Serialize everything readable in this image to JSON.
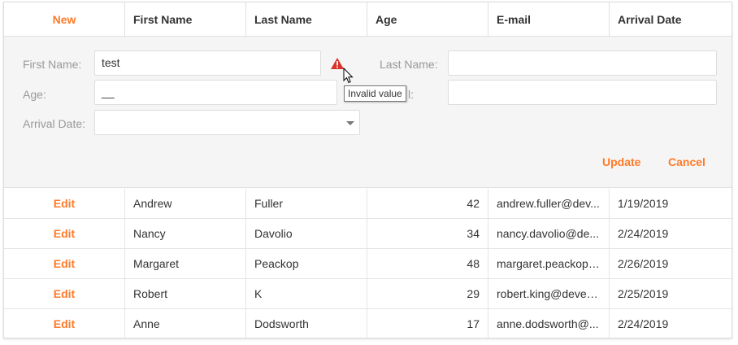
{
  "header": {
    "new_label": "New",
    "columns": [
      "First Name",
      "Last Name",
      "Age",
      "E-mail",
      "Arrival Date"
    ]
  },
  "form": {
    "first_name_label": "First Name:",
    "first_name_value": "test",
    "last_name_label": "Last Name:",
    "last_name_value": "",
    "age_label": "Age:",
    "age_value": "__",
    "email_label_partial": "l:",
    "email_value": "",
    "arrival_label": "Arrival Date:",
    "arrival_value": "",
    "tooltip": "Invalid value",
    "update_label": "Update",
    "cancel_label": "Cancel"
  },
  "rows": [
    {
      "action": "Edit",
      "first": "Andrew",
      "last": "Fuller",
      "age": "42",
      "email": "andrew.fuller@dev...",
      "arrival": "1/19/2019"
    },
    {
      "action": "Edit",
      "first": "Nancy",
      "last": "Davolio",
      "age": "34",
      "email": "nancy.davolio@de...",
      "arrival": "2/24/2019"
    },
    {
      "action": "Edit",
      "first": "Margaret",
      "last": "Peackop",
      "age": "48",
      "email": "margaret.peackop....",
      "arrival": "2/26/2019"
    },
    {
      "action": "Edit",
      "first": "Robert",
      "last": "K",
      "age": "29",
      "email": "robert.king@devex...",
      "arrival": "2/25/2019"
    },
    {
      "action": "Edit",
      "first": "Anne",
      "last": "Dodsworth",
      "age": "17",
      "email": "anne.dodsworth@...",
      "arrival": "2/24/2019"
    }
  ],
  "colors": {
    "accent": "#ff7a28",
    "warning": "#d9342b",
    "form_background": "#f5f5f5"
  }
}
